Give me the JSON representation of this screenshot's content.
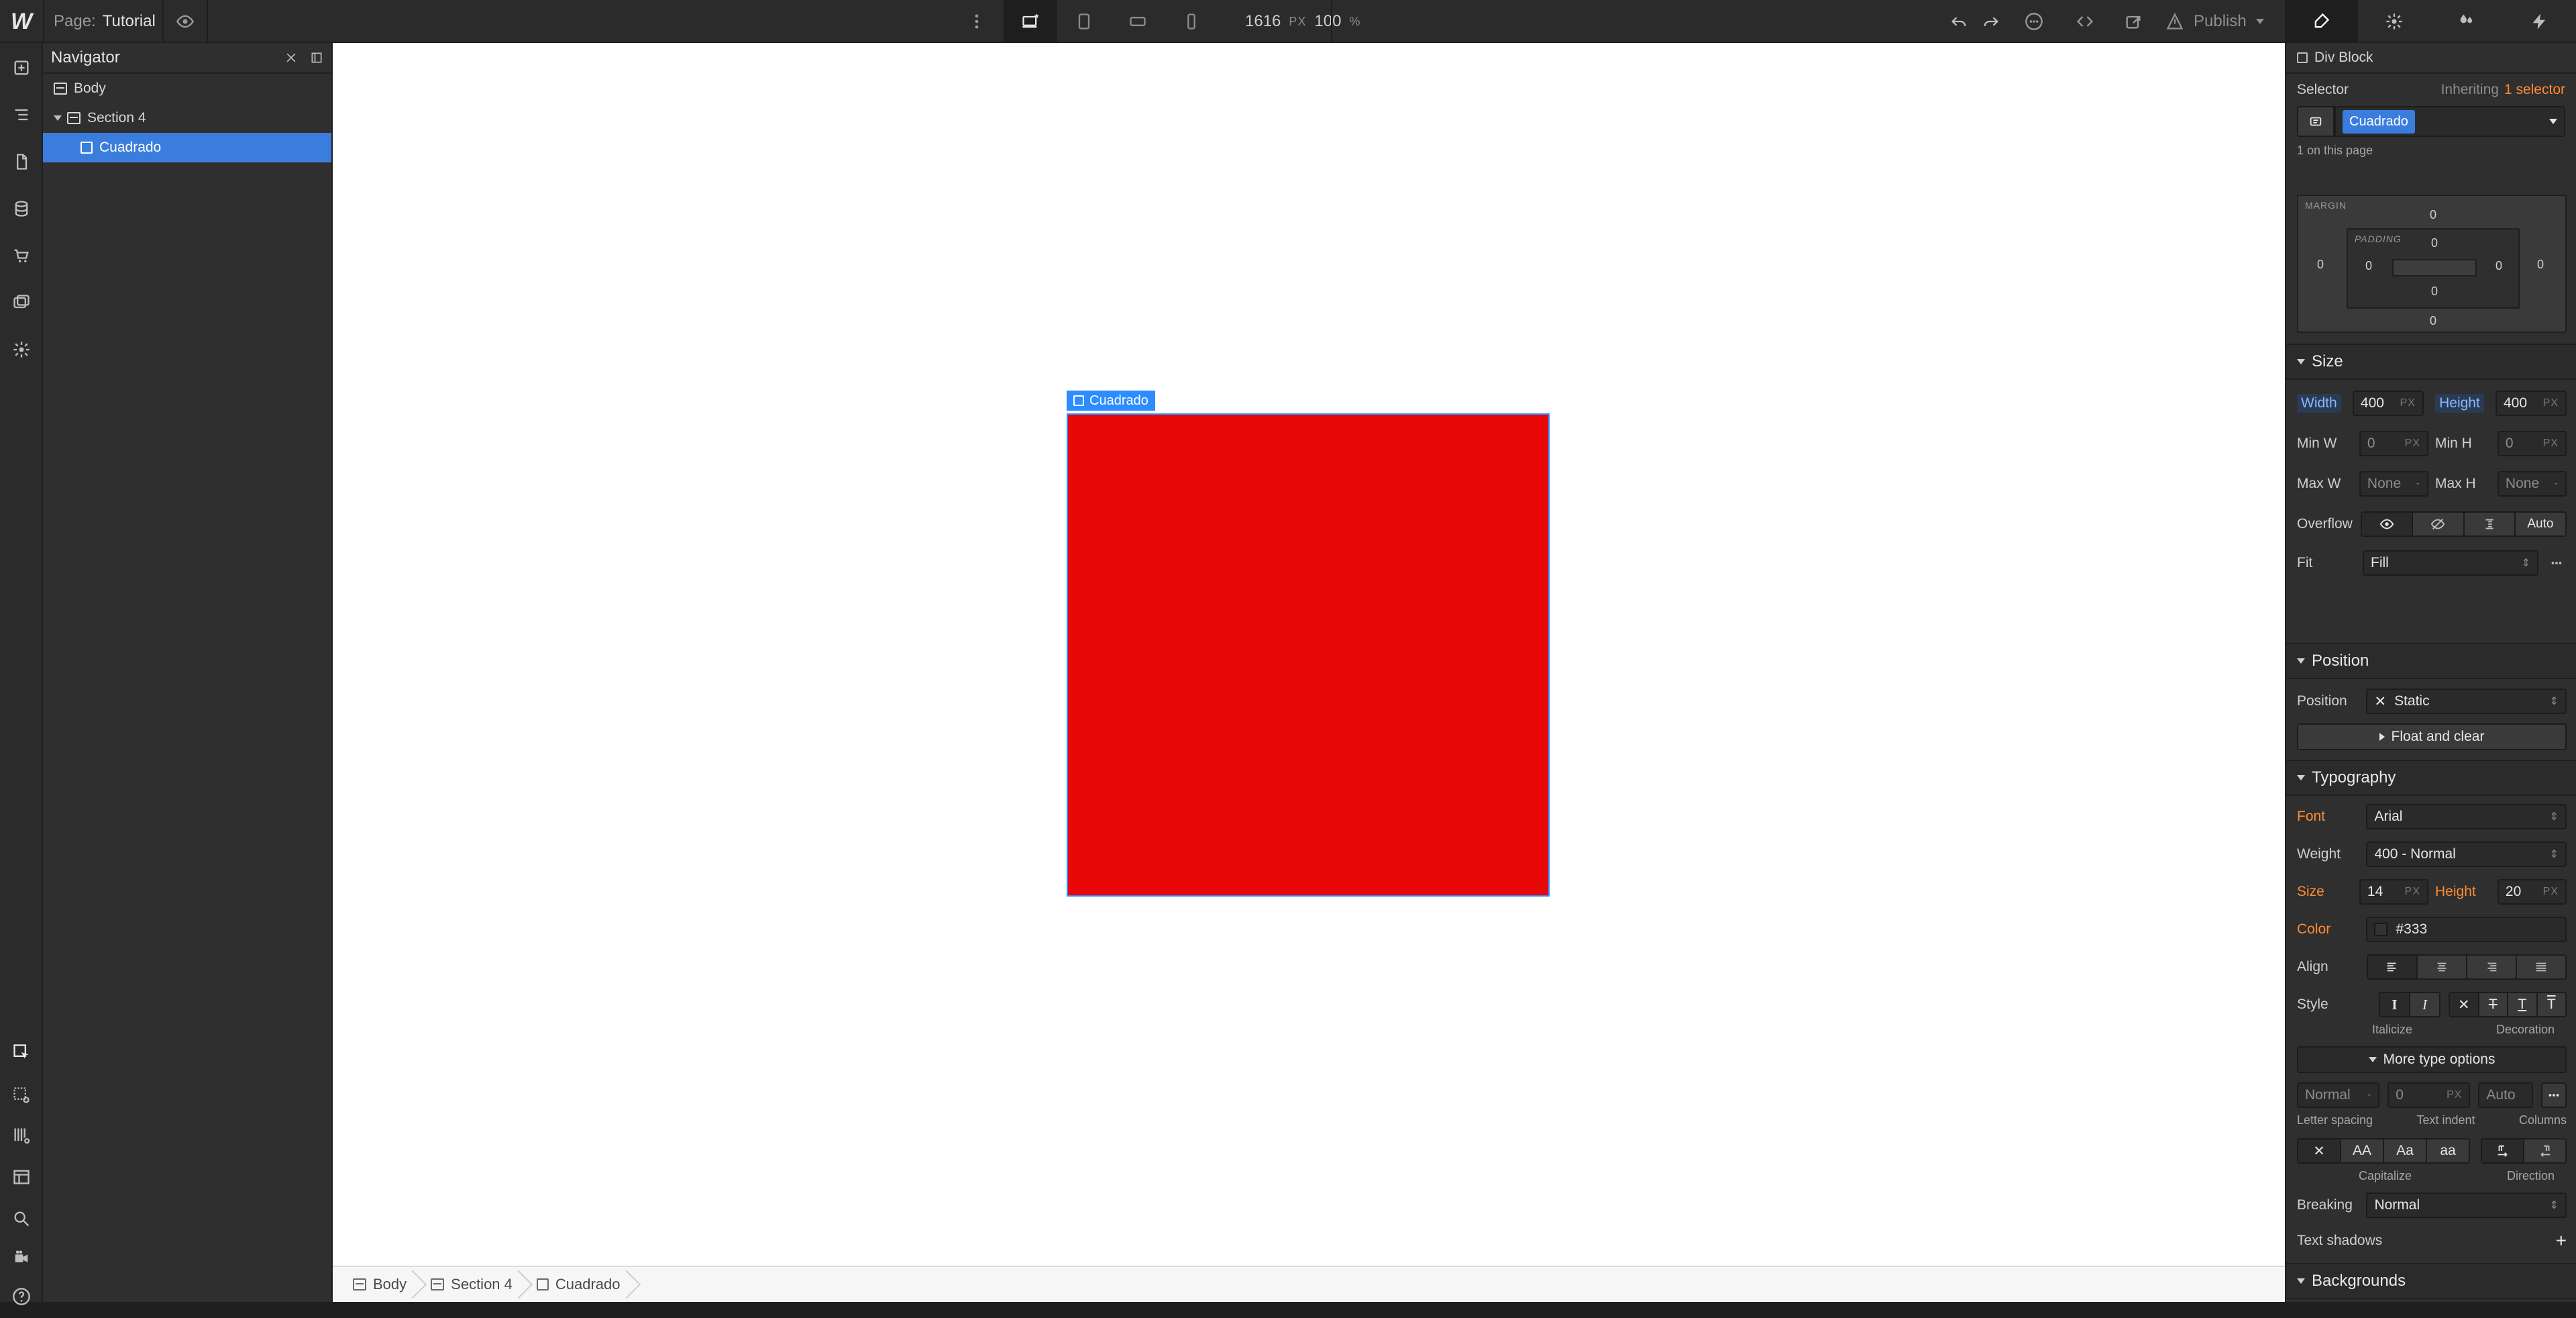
{
  "topbar": {
    "logo_text": "W",
    "page_key": "Page:",
    "page_name": "Tutorial",
    "width_px": "1616",
    "px_unit": "PX",
    "zoom": "100",
    "zoom_unit": "%",
    "publish_label": "Publish"
  },
  "navigator": {
    "title": "Navigator",
    "items": [
      {
        "label": "Body"
      },
      {
        "label": "Section 4"
      },
      {
        "label": "Cuadrado"
      }
    ]
  },
  "canvas": {
    "selected_tag": "Cuadrado",
    "square_color": "#e80808"
  },
  "breadcrumbs": {
    "items": [
      "Body",
      "Section 4",
      "Cuadrado"
    ]
  },
  "rightpanel": {
    "element_type": "Div Block",
    "selector_label": "Selector",
    "inheriting_text": "Inheriting",
    "inheriting_link": "1 selector",
    "selector_chip": "Cuadrado",
    "on_page": "1 on this page",
    "box_model": {
      "margin_label": "MARGIN",
      "padding_label": "PADDING",
      "margin_top": "0",
      "margin_right": "0",
      "margin_bottom": "0",
      "margin_left": "0",
      "padding_top": "0",
      "padding_right": "0",
      "padding_bottom": "0",
      "padding_left": "0"
    },
    "size": {
      "header": "Size",
      "width_label": "Width",
      "width_value": "400",
      "height_label": "Height",
      "height_value": "400",
      "min_w_label": "Min W",
      "min_w_value": "0",
      "min_h_label": "Min H",
      "min_h_value": "0",
      "max_w_label": "Max W",
      "max_w_value": "None",
      "max_h_label": "Max H",
      "max_h_value": "None",
      "unit_px": "PX",
      "unit_dash": "-",
      "overflow_label": "Overflow",
      "overflow_auto": "Auto",
      "fit_label": "Fit",
      "fit_value": "Fill"
    },
    "position": {
      "header": "Position",
      "label": "Position",
      "value": "Static",
      "float_clear": "Float and clear"
    },
    "typography": {
      "header": "Typography",
      "font_label": "Font",
      "font_value": "Arial",
      "weight_label": "Weight",
      "weight_value": "400 - Normal",
      "size_label": "Size",
      "size_value": "14",
      "line_height_label": "Height",
      "line_height_value": "20",
      "color_label": "Color",
      "color_value": "#333",
      "align_label": "Align",
      "style_label": "Style",
      "italicize_caption": "Italicize",
      "decoration_caption": "Decoration",
      "more_type_options": "More type options",
      "letter_spacing_value": "Normal",
      "text_indent_value": "0",
      "columns_value": "Auto",
      "letter_spacing_caption": "Letter spacing",
      "text_indent_caption": "Text indent",
      "columns_caption": "Columns",
      "capitalize_caption": "Capitalize",
      "direction_caption": "Direction",
      "breaking_label": "Breaking",
      "breaking_value": "Normal",
      "text_shadows_label": "Text shadows"
    },
    "backgrounds": {
      "header": "Backgrounds"
    }
  }
}
